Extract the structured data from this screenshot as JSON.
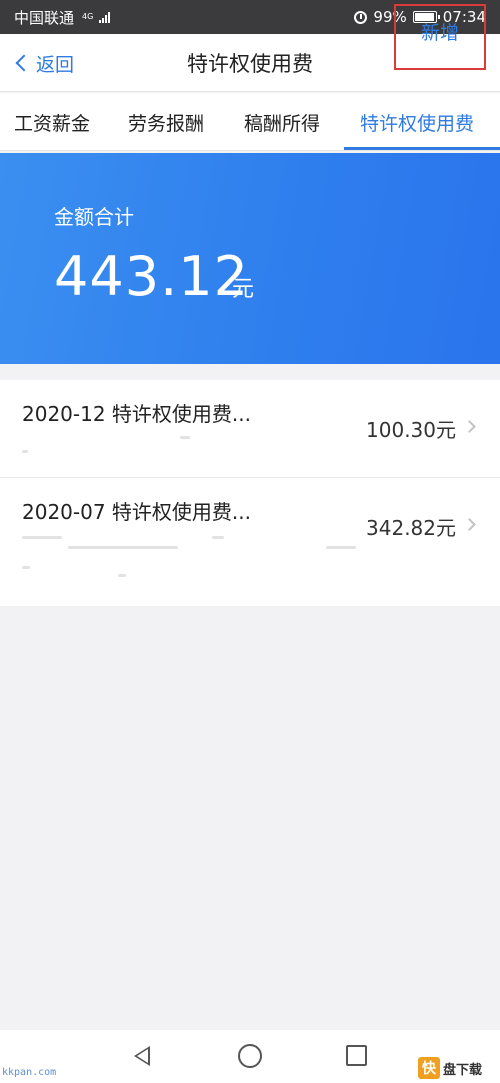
{
  "status_bar": {
    "carrier": "中国联通",
    "network": "4G",
    "battery": "99%",
    "time": "07:34"
  },
  "nav": {
    "back_label": "返回",
    "title": "特许权使用费",
    "add_label": "新增"
  },
  "tabs": [
    {
      "label": "工资薪金"
    },
    {
      "label": "劳务报酬"
    },
    {
      "label": "稿酬所得"
    },
    {
      "label": "特许权使用费",
      "active": true
    }
  ],
  "summary": {
    "label": "金额合计",
    "amount": "443.12",
    "unit": "元"
  },
  "records": [
    {
      "title": "2020-12 特许权使用费...",
      "amount": "100.30元"
    },
    {
      "title": "2020-07 特许权使用费...",
      "amount": "342.82元"
    }
  ],
  "watermark": {
    "site": "kkpan.com",
    "brand": "盘下载"
  },
  "colors": {
    "accent": "#2f7be0",
    "highlight_box": "#d93a3a",
    "summary_bg": "#2f7fee"
  }
}
